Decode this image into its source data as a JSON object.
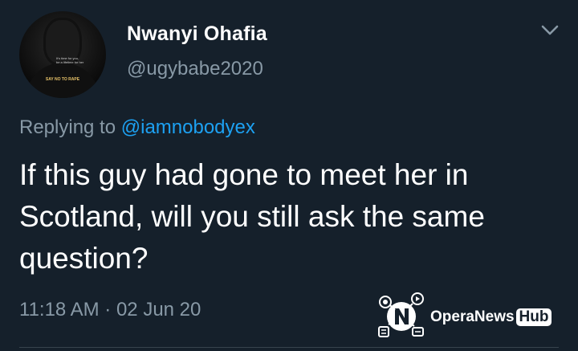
{
  "tweet": {
    "author": {
      "display_name": "Nwanyi Ohafia",
      "handle": "@ugybabe2020",
      "avatar": {
        "shirt_text": "It's time for you,\nbe a lifetime for her",
        "badge_text": "SAY NO TO RAPE"
      }
    },
    "reply": {
      "prefix": "Replying to",
      "mention": "@iamnobodyex"
    },
    "text": "If this guy had gone to meet her in Scotland, will you still ask the same question?",
    "timestamp": "11:18 AM · 02 Jun 20",
    "menu_icon": "chevron-down-icon"
  },
  "watermark": {
    "brand": "OperaNews",
    "suffix": "Hub",
    "logo_icon": "opera-news-logo-icon"
  },
  "colors": {
    "background": "#15202b",
    "primary_text": "#ffffff",
    "secondary_text": "#8899a6",
    "link": "#1da1f2",
    "divider": "#38444d"
  }
}
